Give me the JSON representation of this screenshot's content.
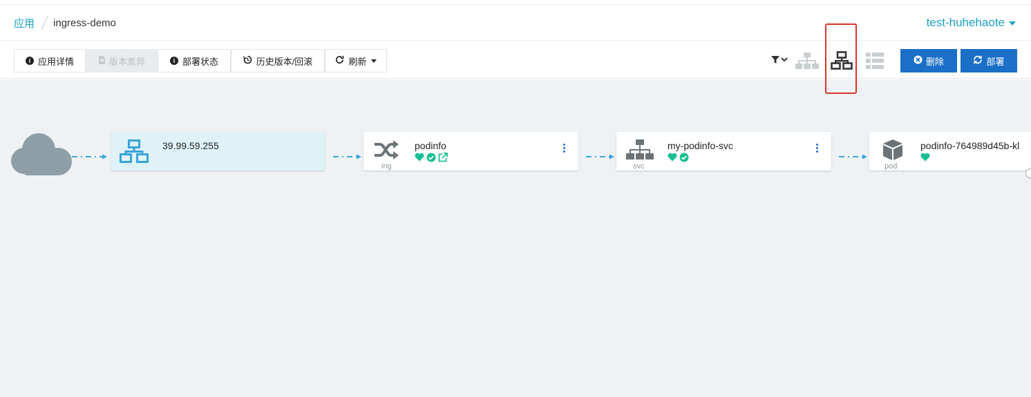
{
  "breadcrumb": {
    "root": "应用",
    "current": "ingress-demo"
  },
  "namespace": {
    "label": "test-huhehaote"
  },
  "toolbar": {
    "app_details": "应用详情",
    "diff": "版本差异",
    "deploy_status": "部署状态",
    "history": "历史版本/回滚",
    "refresh": "刷新",
    "delete": "删除",
    "deploy": "部署"
  },
  "view_icons": [
    "filter-icon",
    "tree-view-icon",
    "network-view-icon",
    "list-view-icon"
  ],
  "graph": {
    "internet": {
      "icon": "cloud-icon"
    },
    "load_balancer": {
      "address": "39.99.59.255",
      "icon": "network-icon"
    },
    "ingress": {
      "name": "podinfo",
      "kind": "ing",
      "icon": "shuffle-icon",
      "status": [
        "heart-icon",
        "check-circle-icon",
        "external-link-icon"
      ]
    },
    "service": {
      "name": "my-podinfo-svc",
      "kind": "svc",
      "icon": "sitemap-icon",
      "status": [
        "heart-icon",
        "check-circle-icon"
      ]
    },
    "pod": {
      "name": "podinfo-764989d45b-kl",
      "kind": "pod",
      "icon": "cube-icon",
      "status": [
        "heart-icon"
      ]
    }
  },
  "colors": {
    "accent": "#1ca0c4",
    "primary_button": "#1b6fc7",
    "healthy": "#18be94",
    "canvas_bg": "#eef2f4",
    "highlight": "#d9342b"
  }
}
